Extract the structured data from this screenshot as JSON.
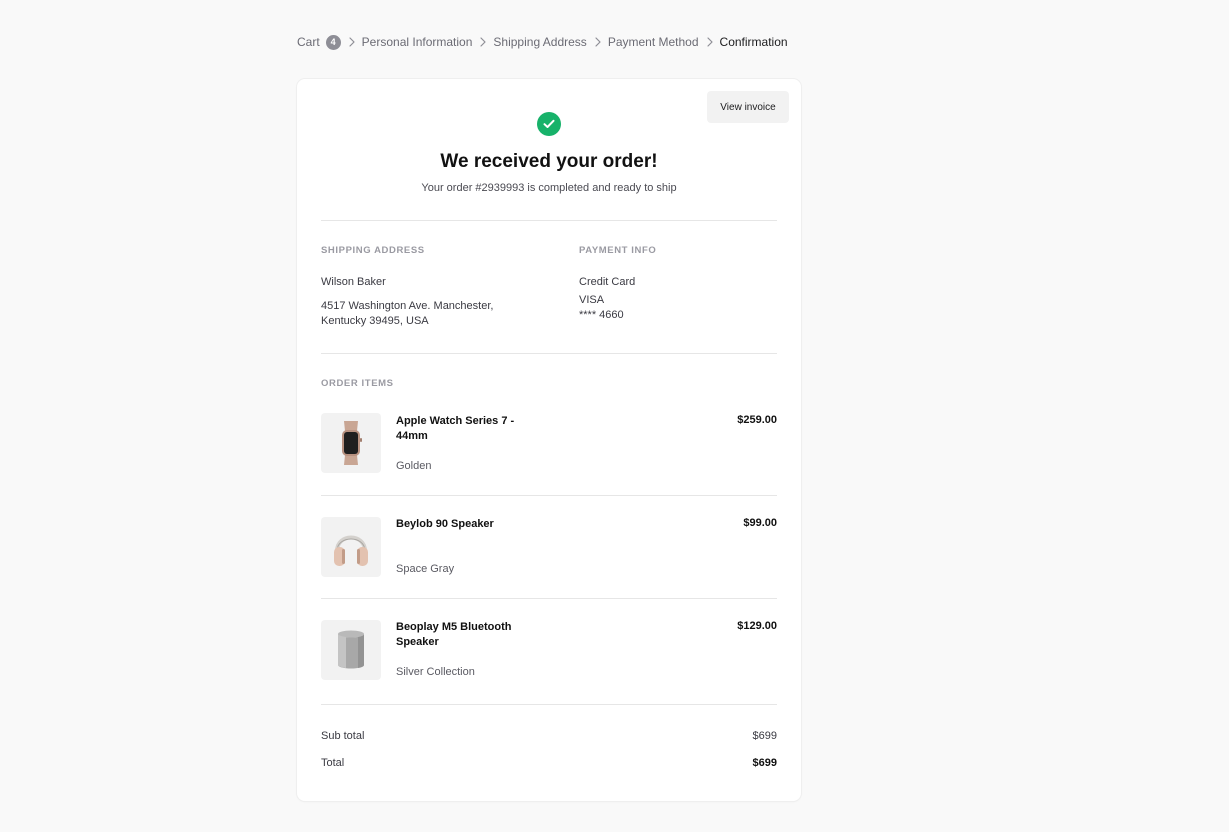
{
  "breadcrumb": {
    "cart_label": "Cart",
    "cart_count": "4",
    "steps": [
      "Personal Information",
      "Shipping Address",
      "Payment Method",
      "Confirmation"
    ]
  },
  "card": {
    "invoice_button": "View invoice",
    "title": "We received your order!",
    "subtitle": "Your order #2939993 is completed and ready to ship"
  },
  "shipping": {
    "label": "SHIPPING ADDRESS",
    "name": "Wilson Baker",
    "address_line1": "4517 Washington Ave. Manchester,",
    "address_line2": "Kentucky 39495, USA"
  },
  "payment": {
    "label": "PAYMENT INFO",
    "method": "Credit Card",
    "brand": "VISA",
    "card_number": "**** 4660"
  },
  "order": {
    "label": "ORDER ITEMS",
    "items": [
      {
        "name": "Apple Watch Series 7 - 44mm",
        "variant": "Golden",
        "price": "$259.00",
        "icon": "watch-icon"
      },
      {
        "name": "Beylob 90 Speaker",
        "variant": "Space Gray",
        "price": "$99.00",
        "icon": "headphones-icon"
      },
      {
        "name": "Beoplay M5 Bluetooth Speaker",
        "variant": "Silver Collection",
        "price": "$129.00",
        "icon": "speaker-icon"
      }
    ]
  },
  "summary": {
    "subtotal_label": "Sub total",
    "subtotal_value": "$699",
    "total_label": "Total",
    "total_value": "$699"
  },
  "colors": {
    "success": "#17b26a",
    "background": "#f9f9f9",
    "card": "#ffffff"
  }
}
